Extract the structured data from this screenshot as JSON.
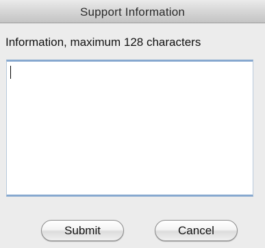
{
  "window": {
    "title": "Support Information"
  },
  "form": {
    "prompt": "Information, maximum 128 characters",
    "textarea_value": ""
  },
  "buttons": {
    "submit_label": "Submit",
    "cancel_label": "Cancel"
  },
  "colors": {
    "focus_ring": "#86a8cf",
    "dialog_background": "#ececec"
  }
}
